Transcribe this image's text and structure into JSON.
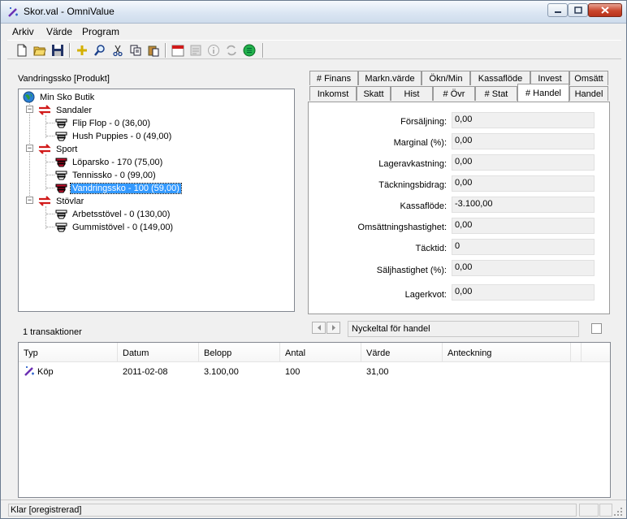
{
  "window": {
    "title": "Skor.val - OmniValue"
  },
  "menu": [
    "Arkiv",
    "Värde",
    "Program"
  ],
  "toolbar": {
    "icons": [
      "new-file-icon",
      "open-folder-icon",
      "save-icon",
      "add-icon",
      "find-icon",
      "cut-icon",
      "copy-icon",
      "paste-icon",
      "calendar-icon",
      "document-icon",
      "info-icon",
      "refresh-icon",
      "list-icon"
    ]
  },
  "tree": {
    "header": "Vandringssko  [Produkt]",
    "root": "Min Sko Butik",
    "groups": [
      {
        "label": "Sandaler",
        "items": [
          "Flip Flop - 0 (36,00)",
          "Hush Puppies - 0 (49,00)"
        ]
      },
      {
        "label": "Sport",
        "items": [
          "Löparsko - 170 (75,00)",
          "Tennissko - 0 (99,00)",
          "Vandringssko - 100 (59,00)"
        ]
      },
      {
        "label": "Stövlar",
        "items": [
          "Arbetsstövel - 0 (130,00)",
          "Gummistövel - 0 (149,00)"
        ]
      }
    ],
    "selected": "Vandringssko - 100 (59,00)"
  },
  "tabs": {
    "row1": [
      "# Finans",
      "Markn.värde",
      "Ökn/Min",
      "Kassaflöde",
      "Invest",
      "Omsätt"
    ],
    "row2": [
      "Inkomst",
      "Skatt",
      "Hist",
      "# Övr",
      "# Stat",
      "# Handel",
      "Handel"
    ],
    "active": "# Handel"
  },
  "fields": [
    {
      "label": "Försäljning:",
      "value": "0,00"
    },
    {
      "label": "Marginal (%):",
      "value": "0,00"
    },
    {
      "label": "Lageravkastning:",
      "value": "0,00"
    },
    {
      "label": "Täckningsbidrag:",
      "value": "0,00"
    },
    {
      "label": "Kassaflöde:",
      "value": "-3.100,00"
    },
    {
      "label": "Omsättningshastighet:",
      "value": "0,00"
    },
    {
      "label": "Täcktid:",
      "value": "0"
    },
    {
      "label": "Säljhastighet (%):",
      "value": "0,00"
    },
    {
      "label": "Lagerkvot:",
      "value": "0,00"
    }
  ],
  "transactions": {
    "count_label": "1 transaktioner",
    "nyckeltal": "Nyckeltal för handel",
    "columns": [
      "Typ",
      "Datum",
      "Belopp",
      "Antal",
      "Värde",
      "Anteckning"
    ],
    "rows": [
      {
        "typ": "Köp",
        "datum": "2011-02-08",
        "belopp": "3.100,00",
        "antal": "100",
        "varde": "31,00",
        "anteckning": ""
      }
    ]
  },
  "status": {
    "text": "Klar [oregistrerad]"
  },
  "colors": {
    "selection": "#3399ff",
    "arrow_red": "#d11a1a",
    "shoe_red": "#c8102e",
    "close_red": "#c9462c"
  }
}
